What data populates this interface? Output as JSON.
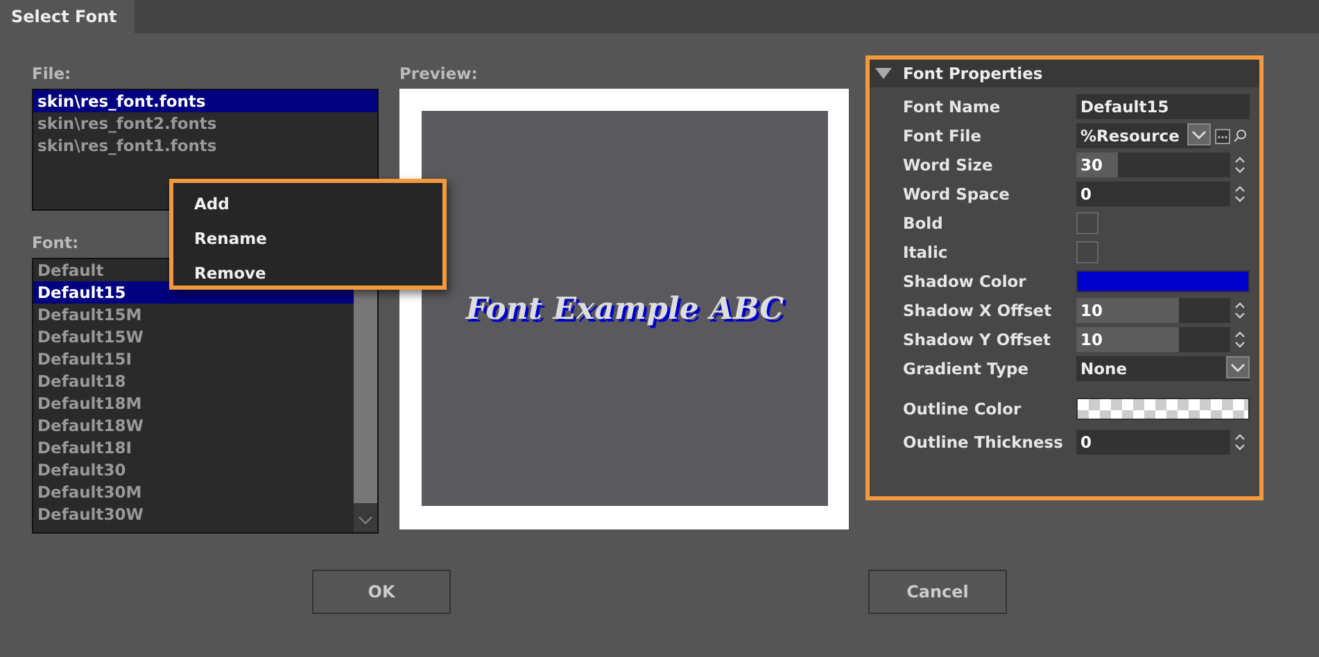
{
  "window": {
    "title": "Select Font"
  },
  "file_section": {
    "label": "File:",
    "items": [
      {
        "text": "skin\\res_font.fonts",
        "selected": true
      },
      {
        "text": "skin\\res_font2.fonts",
        "selected": false
      },
      {
        "text": "skin\\res_font1.fonts",
        "selected": false
      }
    ]
  },
  "context_menu": {
    "items": [
      "Add",
      "Rename",
      "Remove"
    ]
  },
  "font_section": {
    "label": "Font:",
    "items": [
      {
        "text": "Default",
        "selected": false
      },
      {
        "text": "Default15",
        "selected": true
      },
      {
        "text": "Default15M",
        "selected": false
      },
      {
        "text": "Default15W",
        "selected": false
      },
      {
        "text": "Default15I",
        "selected": false
      },
      {
        "text": "Default18",
        "selected": false
      },
      {
        "text": "Default18M",
        "selected": false
      },
      {
        "text": "Default18W",
        "selected": false
      },
      {
        "text": "Default18I",
        "selected": false
      },
      {
        "text": "Default30",
        "selected": false
      },
      {
        "text": "Default30M",
        "selected": false
      },
      {
        "text": "Default30W",
        "selected": false
      }
    ]
  },
  "preview": {
    "label": "Preview:",
    "sample_text": "Font Example ABC"
  },
  "properties": {
    "title": "Font Properties",
    "expanded": true,
    "rows": [
      {
        "kind": "text",
        "label": "Font Name",
        "value": "Default15"
      },
      {
        "kind": "file",
        "label": "Font File",
        "value": "%Resource"
      },
      {
        "kind": "spin",
        "label": "Word Size",
        "value": "30",
        "level": 0.27
      },
      {
        "kind": "spin",
        "label": "Word Space",
        "value": "0"
      },
      {
        "kind": "check",
        "label": "Bold",
        "checked": false
      },
      {
        "kind": "check",
        "label": "Italic",
        "checked": false
      },
      {
        "kind": "color",
        "label": "Shadow Color",
        "color": "#0000cc"
      },
      {
        "kind": "spin",
        "label": "Shadow X Offset",
        "value": "10",
        "level": 0.67
      },
      {
        "kind": "spin",
        "label": "Shadow Y Offset",
        "value": "10",
        "level": 0.67
      },
      {
        "kind": "select",
        "label": "Gradient Type",
        "value": "None"
      },
      {
        "kind": "transparent_color",
        "label": "Outline Color"
      },
      {
        "kind": "spin",
        "label": "Outline Thickness",
        "value": "0"
      }
    ]
  },
  "buttons": [
    "OK",
    "Cancel"
  ]
}
